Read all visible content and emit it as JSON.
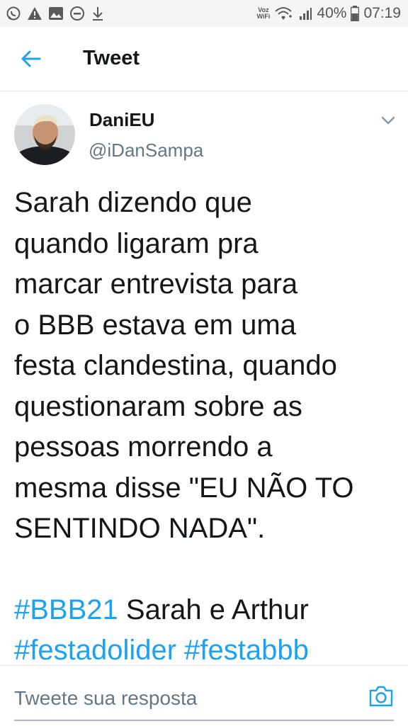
{
  "status_bar": {
    "network_label_top": "Voz",
    "network_label_bottom": "WiFi",
    "battery": "40%",
    "time": "07:19",
    "icons": [
      "whatsapp-icon",
      "warning-icon",
      "image-icon",
      "do-not-disturb-icon",
      "download-icon",
      "wifi-icon",
      "signal-icon",
      "battery-icon"
    ]
  },
  "header": {
    "back_icon": "arrow-left-icon",
    "title": "Tweet"
  },
  "tweet": {
    "author_name": "DaniEU",
    "author_handle": "@iDanSampa",
    "menu_icon": "chevron-down-icon",
    "text": "Sarah dizendo que\nquando ligaram pra\nmarcar entrevista para\no BBB estava em uma\nfesta clandestina, quando\nquestionaram sobre as\npessoas morrendo a\nmesma disse \"EU NÃO TO\nSENTINDO NADA\".",
    "hashtag_1": "#BBB21",
    "plain_text": " Sarah e Arthur",
    "hashtag_2": "#festadolider",
    "hashtag_3": "#festabbb"
  },
  "reply": {
    "placeholder": "Tweete sua resposta",
    "camera_icon": "camera-icon"
  },
  "colors": {
    "accent": "#1da1f2",
    "secondary_text": "#657786",
    "primary_text": "#14171a",
    "status_bar_bg": "#f5f5f5"
  }
}
